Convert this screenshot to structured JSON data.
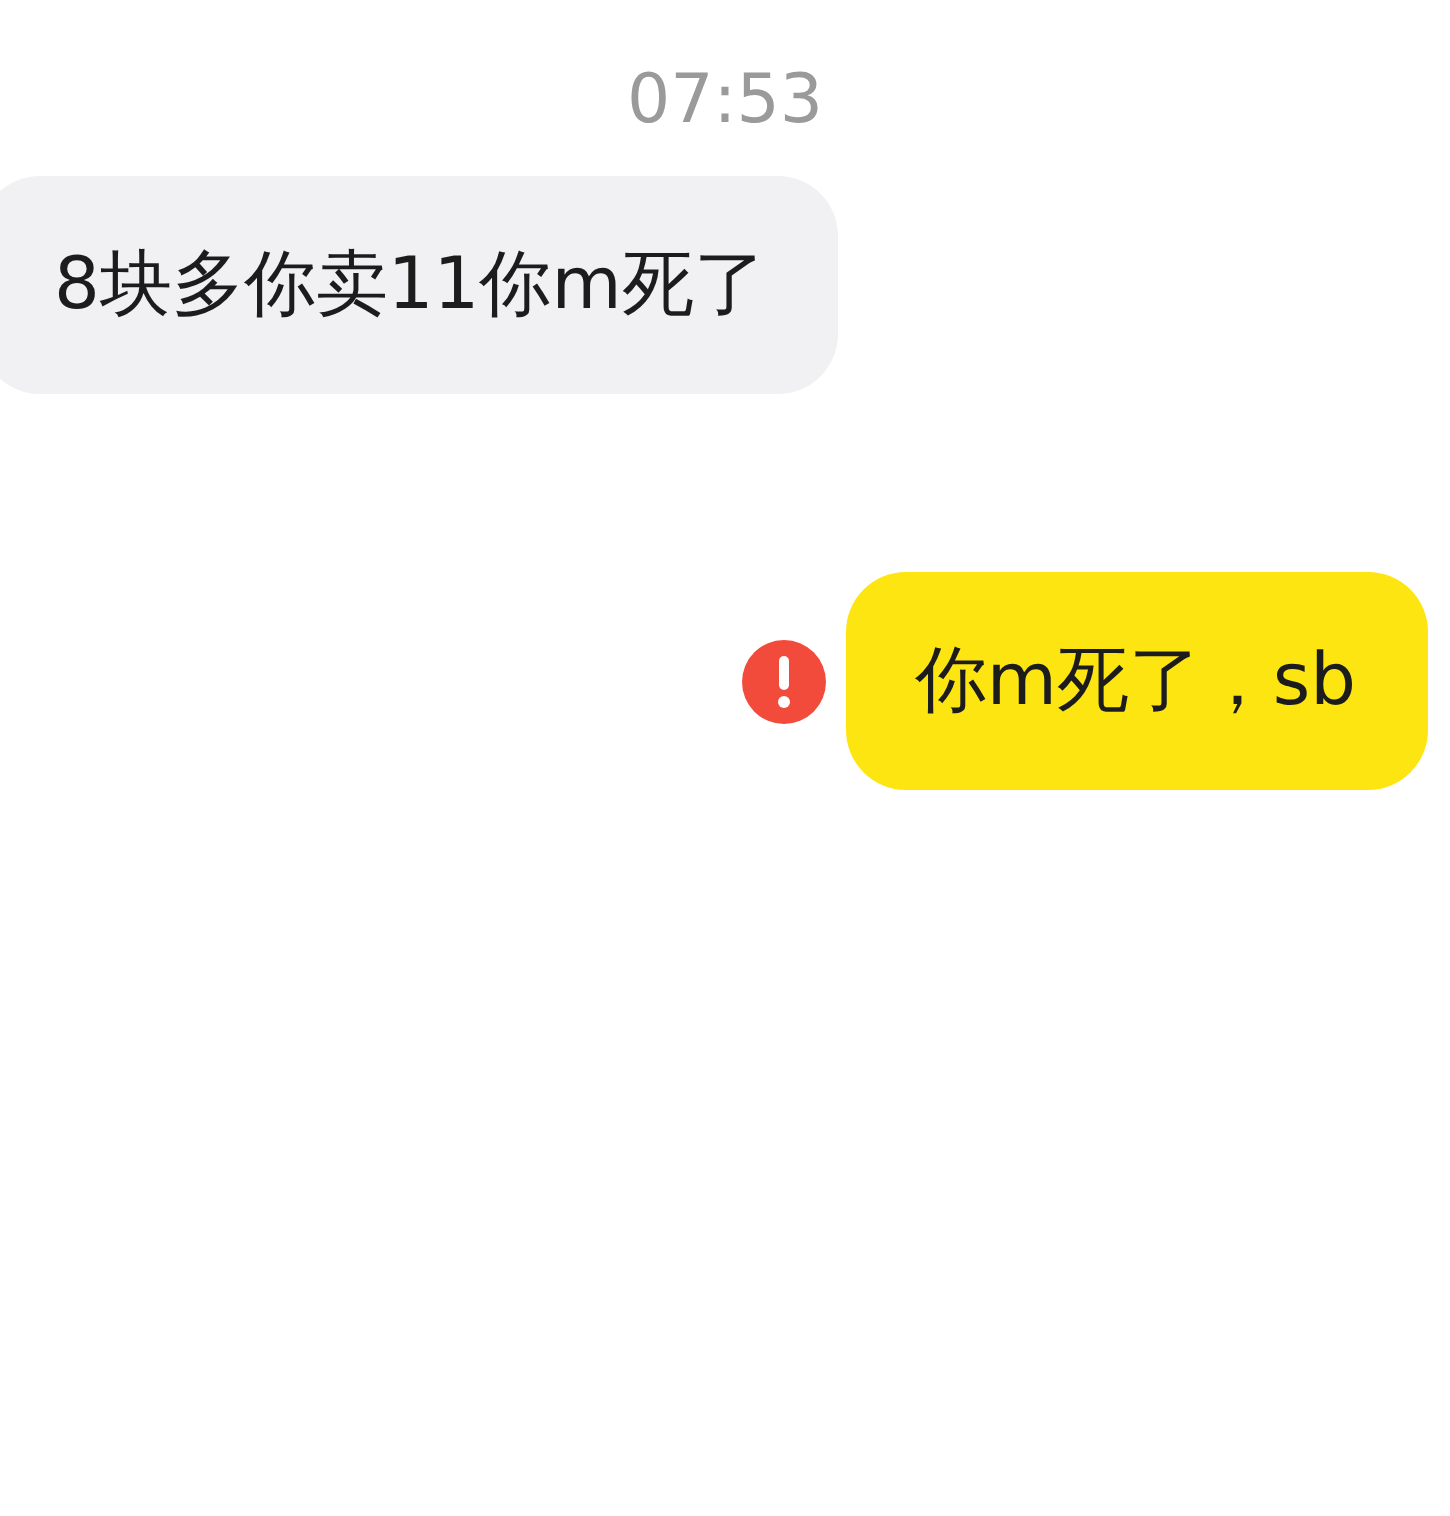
{
  "timestamp": "07:53",
  "messages": [
    {
      "kind": "incoming",
      "text": "8块多你卖11你m死了",
      "failed": false
    },
    {
      "kind": "outgoing",
      "text": "你m死了，sb",
      "failed": true
    }
  ]
}
